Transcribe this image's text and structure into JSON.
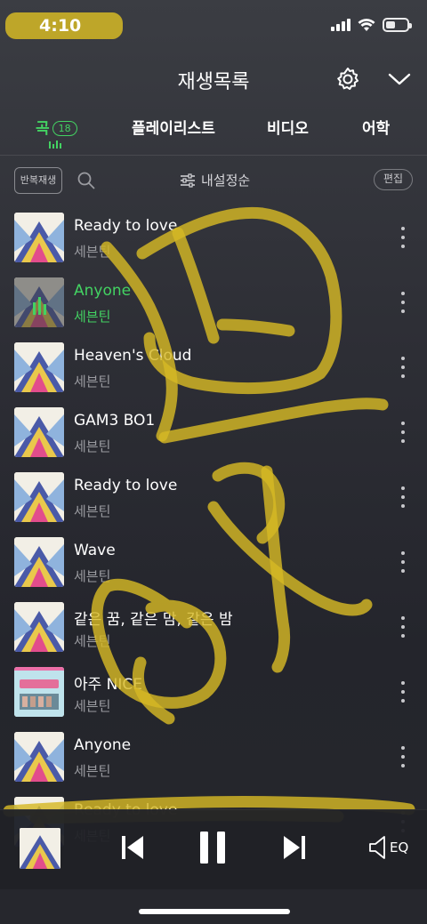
{
  "status": {
    "time": "4:10",
    "battery_level": 0.45
  },
  "header": {
    "title": "재생목록"
  },
  "tabs": [
    {
      "label": "곡",
      "badge": "18",
      "active": true
    },
    {
      "label": "플레이리스트"
    },
    {
      "label": "비디오"
    },
    {
      "label": "어학"
    }
  ],
  "toolbar": {
    "repeat_label": "반복재생",
    "sort_label": "내설정순",
    "edit_label": "편집"
  },
  "songs": [
    {
      "title": "Ready to love",
      "artist": "세븐틴",
      "cover": "blue-yellow"
    },
    {
      "title": "Anyone",
      "artist": "세븐틴",
      "cover": "blue-yellow",
      "playing": true
    },
    {
      "title": "Heaven's Cloud",
      "artist": "세븐틴",
      "cover": "blue-yellow"
    },
    {
      "title": "GAM3 BO1",
      "artist": "세븐틴",
      "cover": "blue-yellow"
    },
    {
      "title": "Ready to love",
      "artist": "세븐틴",
      "cover": "blue-yellow"
    },
    {
      "title": "Wave",
      "artist": "세븐틴",
      "cover": "blue-yellow"
    },
    {
      "title": "같은 꿈, 같은 맘, 같은 밤",
      "artist": "세븐틴",
      "cover": "blue-yellow"
    },
    {
      "title": "아주 NICE",
      "artist": "세븐틴",
      "cover": "seventeen-pink"
    },
    {
      "title": "Anyone",
      "artist": "세븐틴",
      "cover": "blue-yellow"
    },
    {
      "title": "Ready to love",
      "artist": "세븐틴",
      "cover": "blue-yellow"
    }
  ],
  "player": {
    "eq_label": "EQ",
    "state": "playing"
  },
  "colors": {
    "accent": "#43d262",
    "background": "#2e2f36",
    "scribble": "#d6b824"
  },
  "icons": [
    "settings-gear-icon",
    "chevron-down-icon",
    "search-icon",
    "sort-sliders-icon",
    "more-icon",
    "previous-icon",
    "pause-icon",
    "next-icon",
    "eq-speaker-icon"
  ]
}
